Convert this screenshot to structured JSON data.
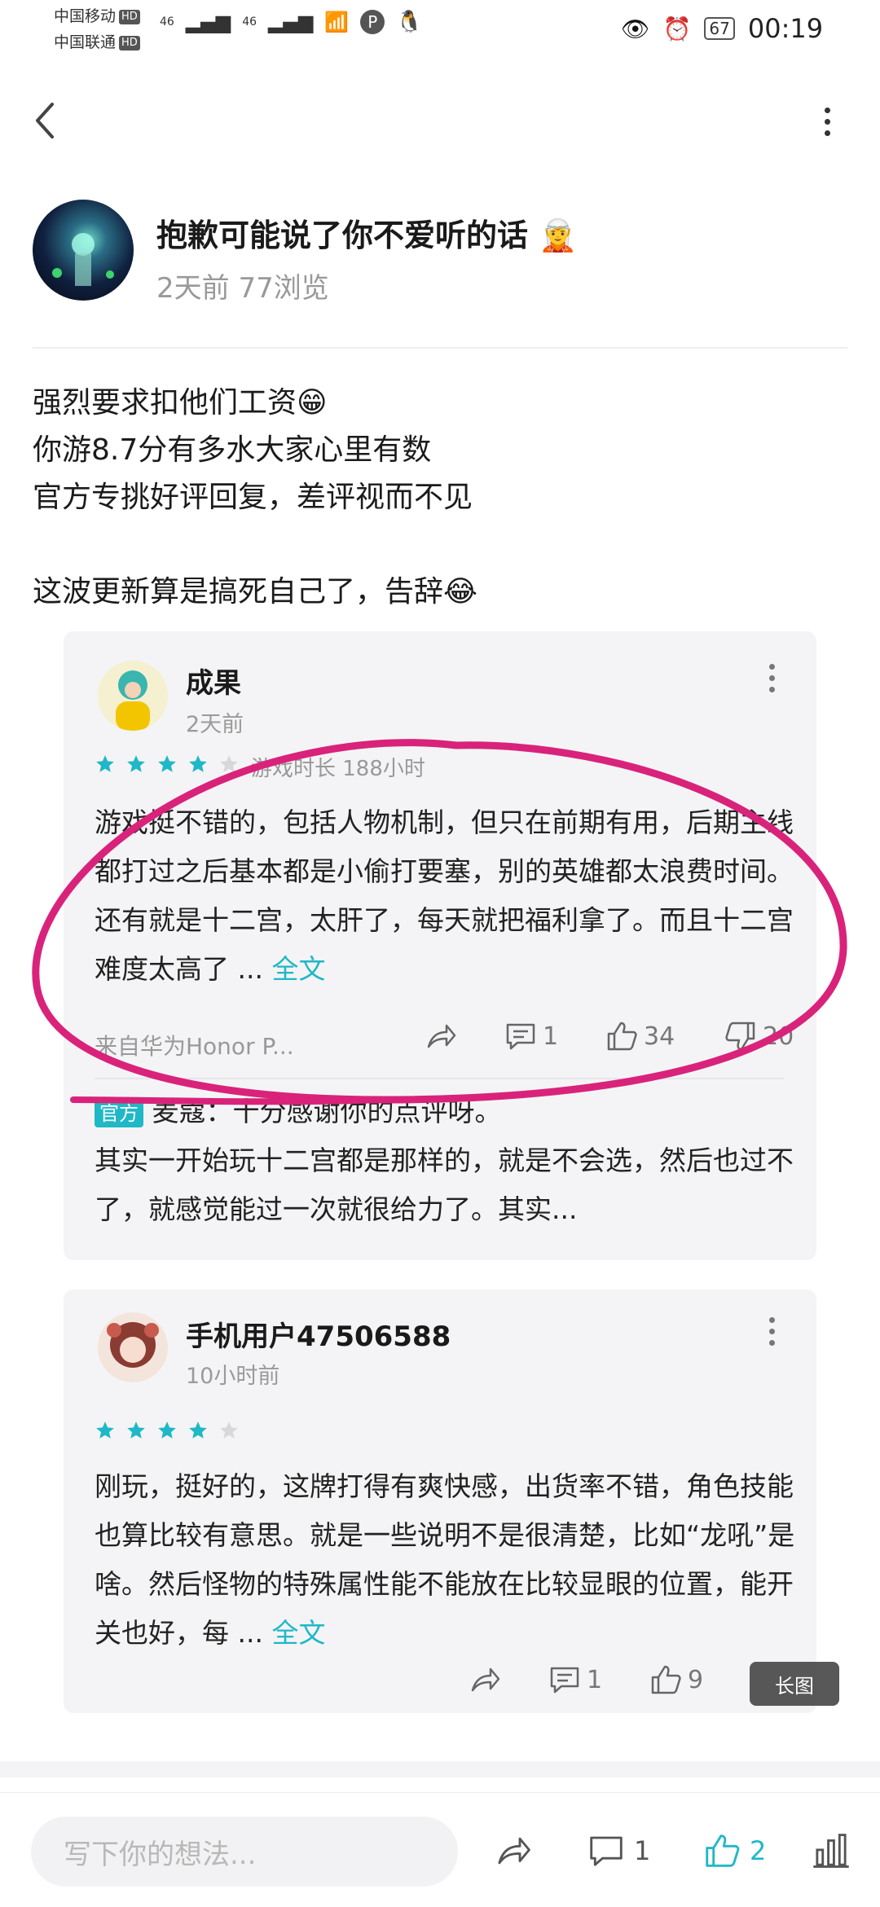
{
  "status_bar": {
    "carrier1": "中国移动",
    "carrier2": "中国联通",
    "hd": "HD",
    "net": "46",
    "battery": "67",
    "time": "00:19"
  },
  "post": {
    "title": "抱歉可能说了你不爱听的话 🧝",
    "meta": "2天前 77浏览",
    "lines": [
      "强烈要求扣他们工资😁",
      "你游8.7分有多水大家心里有数",
      "官方专挑好评回复，差评视而不见",
      "",
      "这波更新算是搞死自己了，告辞😂"
    ]
  },
  "review1": {
    "name": "成果",
    "time": "2天前",
    "stars": 4,
    "playtime": "游戏时长 188小时",
    "text": "游戏挺不错的，包括人物机制，但只在前期有用，后期主线都打过之后基本都是小偷打要塞，别的英雄都太浪费时间。还有就是十二宫，太肝了，每天就把福利拿了。而且十二宫难度太高了 ... ",
    "full": "全文",
    "source": "来自华为Honor P...",
    "comments": "1",
    "likes": "34",
    "dislikes": "20",
    "reply_tag": "官方",
    "reply_head": "麦蔻：十分感谢你的点评呀。",
    "reply_text": "其实一开始玩十二宫都是那样的，就是不会选，然后也过不了，就感觉能过一次就很给力了。其实..."
  },
  "review2": {
    "name": "手机用户47506588",
    "time": "10小时前",
    "stars": 4,
    "text": "刚玩，挺好的，这牌打得有爽快感，出货率不错，角色技能也算比较有意思。就是一些说明不是很清楚，比如“龙吼”是啥。然后怪物的特殊属性能不能放在比较显眼的位置，能开关也好，每 ... ",
    "full": "全文",
    "comments": "1",
    "likes": "9"
  },
  "overlay": {
    "changtu": "长图"
  },
  "bottom_bar": {
    "placeholder": "写下你的想法...",
    "comments": "1",
    "likes": "2"
  },
  "colors": {
    "accent": "#1fb8c6",
    "star_on": "#1fb8c6",
    "star_off": "#d8d8d8",
    "annotation": "#d9237a"
  }
}
